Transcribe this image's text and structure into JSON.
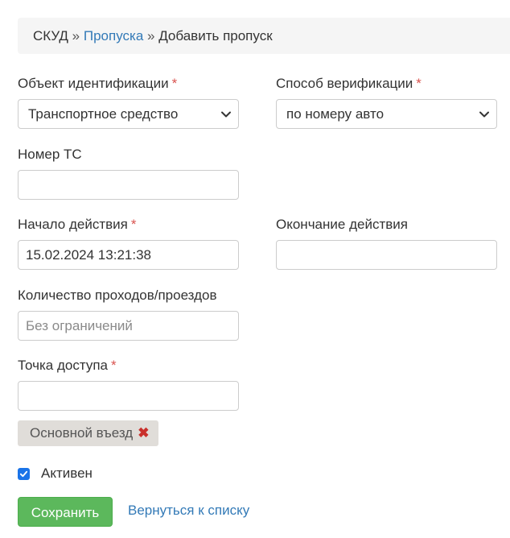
{
  "breadcrumb": {
    "root": "СКУД",
    "separator": "»",
    "section": "Пропуска",
    "current": "Добавить пропуск"
  },
  "form": {
    "identification_object": {
      "label": "Объект идентификации",
      "required_mark": "*",
      "value": "Транспортное средство"
    },
    "verification_method": {
      "label": "Способ верификации",
      "required_mark": "*",
      "value": "по номеру авто"
    },
    "vehicle_number": {
      "label": "Номер ТС",
      "value": ""
    },
    "start_date": {
      "label": "Начало действия",
      "required_mark": "*",
      "value": "15.02.2024 13:21:38"
    },
    "end_date": {
      "label": "Окончание действия",
      "value": ""
    },
    "pass_count": {
      "label": "Количество проходов/проездов",
      "placeholder": "Без ограничений",
      "value": ""
    },
    "access_point": {
      "label": "Точка доступа",
      "required_mark": "*",
      "value": "",
      "selected_tags": [
        "Основной въезд"
      ],
      "remove_glyph": "✖"
    },
    "active": {
      "label": "Активен",
      "checked": true
    }
  },
  "actions": {
    "save_label": "Сохранить",
    "back_label": "Вернуться к списку"
  },
  "colors": {
    "link": "#337ab7",
    "required": "#d9534f",
    "save_button": "#5cb85c",
    "checkbox": "#1a73e8",
    "tag_bg": "#e0ddd9",
    "tag_remove": "#c9302c",
    "breadcrumb_bg": "#f5f5f5"
  },
  "icons": {
    "select_arrow": "chevron-down-icon",
    "tag_remove": "close-icon",
    "checkbox": "check-icon"
  }
}
